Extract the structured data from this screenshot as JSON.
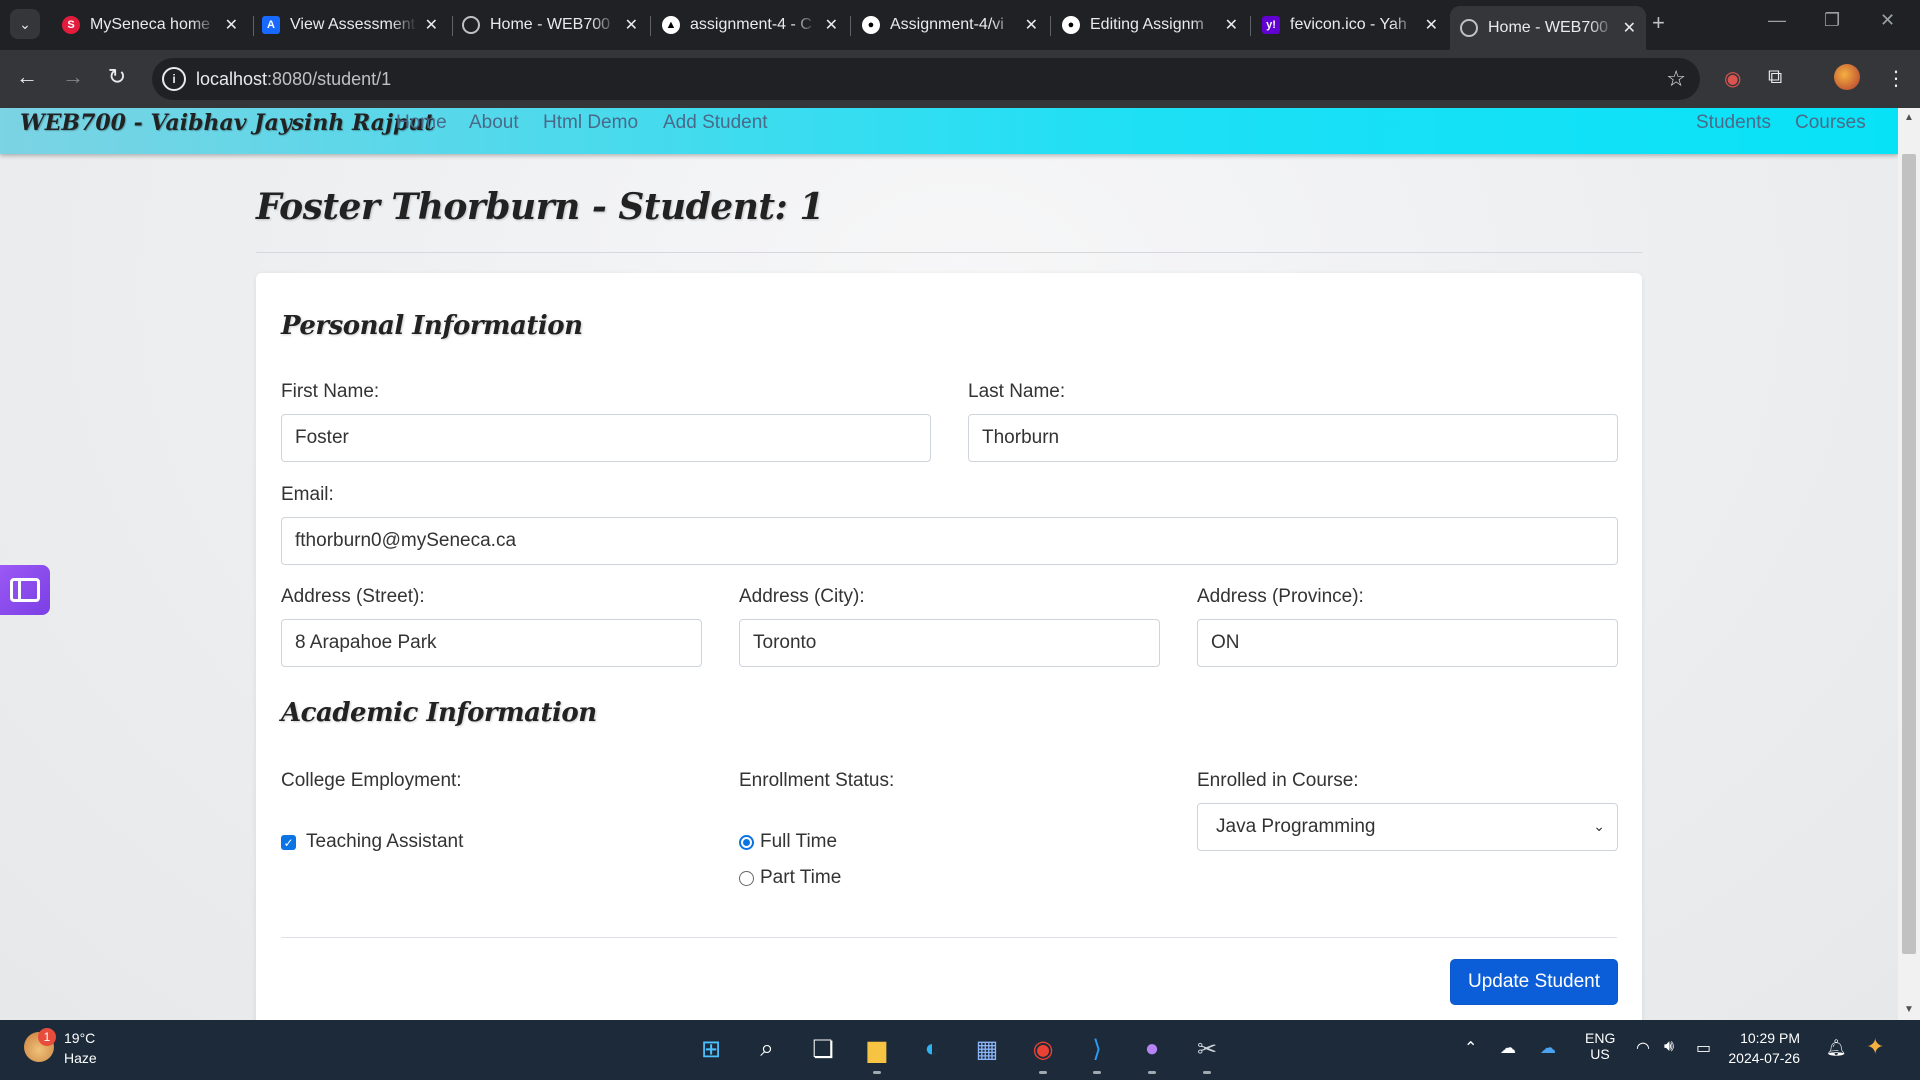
{
  "browser": {
    "tabs": [
      {
        "title": "MySeneca home",
        "favicon_color": "#e31c3d",
        "favicon_glyph": "S"
      },
      {
        "title": "View Assessment",
        "favicon_color": "#1769ff",
        "favicon_glyph": "A"
      },
      {
        "title": "Home - WEB700",
        "favicon_color": "#5f6368",
        "favicon_glyph": "globe-icon"
      },
      {
        "title": "assignment-4 - C",
        "favicon_color": "#000000",
        "favicon_glyph": "vercel-icon"
      },
      {
        "title": "Assignment-4/vi",
        "favicon_color": "#ffffff",
        "favicon_glyph": "github-icon"
      },
      {
        "title": "Editing Assignm",
        "favicon_color": "#ffffff",
        "favicon_glyph": "github-icon"
      },
      {
        "title": "fevicon.ico - Yah",
        "favicon_color": "#6001d2",
        "favicon_glyph": "y!"
      },
      {
        "title": "Home - WEB700",
        "favicon_color": "#5f6368",
        "favicon_glyph": "globe-icon"
      }
    ],
    "active_tab_index": 7,
    "url_host": "localhost",
    "url_path": ":8080/student/1"
  },
  "navbar": {
    "brand": "WEB700 - Vaibhav Jaysinh Rajput",
    "links": [
      "Home",
      "About",
      "Html Demo",
      "Add Student"
    ],
    "right_links": [
      "Students",
      "Courses"
    ]
  },
  "page": {
    "title": "Foster Thorburn - Student: 1"
  },
  "form": {
    "personal_heading": "Personal Information",
    "first_name_label": "First Name:",
    "first_name_value": "Foster",
    "last_name_label": "Last Name:",
    "last_name_value": "Thorburn",
    "email_label": "Email:",
    "email_value": "fthorburn0@mySeneca.ca",
    "street_label": "Address (Street):",
    "street_value": "8 Arapahoe Park",
    "city_label": "Address (City):",
    "city_value": "Toronto",
    "province_label": "Address (Province):",
    "province_value": "ON",
    "academic_heading": "Academic Information",
    "employment_label": "College Employment:",
    "ta_label": "Teaching Assistant",
    "ta_checked": true,
    "status_label": "Enrollment Status:",
    "status_options": [
      "Full Time",
      "Part Time"
    ],
    "status_selected": "Full Time",
    "course_label": "Enrolled in Course:",
    "course_selected": "Java Programming",
    "submit_label": "Update Student"
  },
  "taskbar": {
    "temperature": "19°C",
    "weather": "Haze",
    "notification_count": "1",
    "lang_primary": "ENG",
    "lang_secondary": "US",
    "time": "10:29 PM",
    "date": "2024-07-26"
  },
  "colors": {
    "navbar_gradient_end": "#08e2f7",
    "primary_button": "#0b5ed7",
    "nav_link": "#4a6a8a"
  }
}
